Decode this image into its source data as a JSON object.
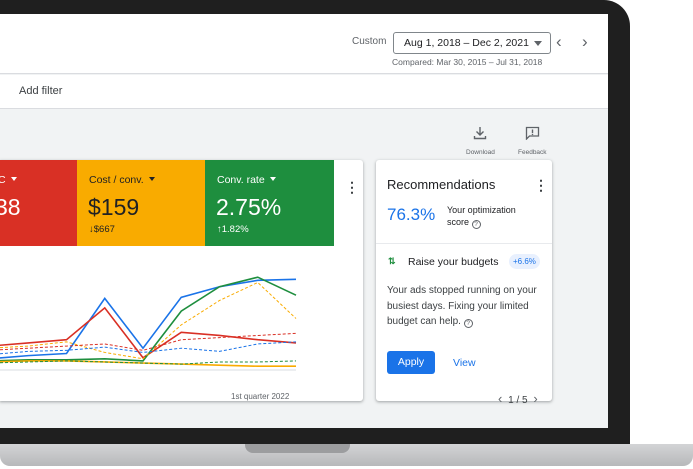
{
  "header": {
    "date_label": "Custom",
    "date_range": "Aug 1, 2018 – Dec 2, 2021",
    "compared": "Compared: Mar 30, 2015 – Jul 31, 2018",
    "prev_icon": "chevron-left-icon",
    "next_icon": "chevron-right-icon"
  },
  "filter": {
    "add_filter": "Add filter"
  },
  "tools": {
    "download": "Download",
    "feedback": "Feedback"
  },
  "metrics": [
    {
      "name": "C",
      "value": "38",
      "delta": "",
      "color": "#d93025"
    },
    {
      "name": "Cost / conv.",
      "value": "$159",
      "delta": "↓$667",
      "color": "#f9ab00"
    },
    {
      "name": "Conv. rate",
      "value": "2.75%",
      "delta": "↑1.82%",
      "color": "#1e8e3e"
    }
  ],
  "chart_data": {
    "type": "line",
    "x_label": "1st quarter 2022",
    "x": [
      0,
      1,
      2,
      3,
      4,
      5,
      6,
      7,
      8
    ],
    "series": [
      {
        "color": "#1a73e8",
        "style": "solid",
        "values": [
          20,
          23,
          25,
          77,
          30,
          78,
          88,
          94,
          95
        ]
      },
      {
        "color": "#d93025",
        "style": "solid",
        "values": [
          32,
          35,
          38,
          68,
          21,
          45,
          42,
          38,
          35
        ]
      },
      {
        "color": "#1e8e3e",
        "style": "solid",
        "values": [
          18,
          19,
          19,
          20,
          18,
          65,
          88,
          97,
          80
        ]
      },
      {
        "color": "#f9ab00",
        "style": "solid",
        "values": [
          17,
          18,
          18,
          17,
          16,
          15,
          14,
          13,
          13
        ]
      },
      {
        "color": "#f9ab00",
        "style": "dashed",
        "values": [
          30,
          32,
          36,
          26,
          20,
          52,
          75,
          92,
          58
        ]
      },
      {
        "color": "#1a73e8",
        "style": "dashed",
        "values": [
          24,
          27,
          28,
          31,
          26,
          30,
          27,
          34,
          36
        ]
      },
      {
        "color": "#d93025",
        "style": "dashed",
        "values": [
          28,
          30,
          32,
          34,
          28,
          38,
          40,
          42,
          44
        ]
      },
      {
        "color": "#1e8e3e",
        "style": "dashed",
        "values": [
          16,
          17,
          18,
          17,
          16,
          15,
          17,
          17,
          18
        ]
      }
    ]
  },
  "recommendations": {
    "title": "Recommendations",
    "score": "76.3%",
    "score_label": "Your optimization score",
    "item_title": "Raise your budgets",
    "uplift": "+6.6%",
    "description": "Your ads stopped running on your busiest days. Fixing your limited budget can help.",
    "apply": "Apply",
    "view": "View",
    "pager": "1 / 5"
  }
}
